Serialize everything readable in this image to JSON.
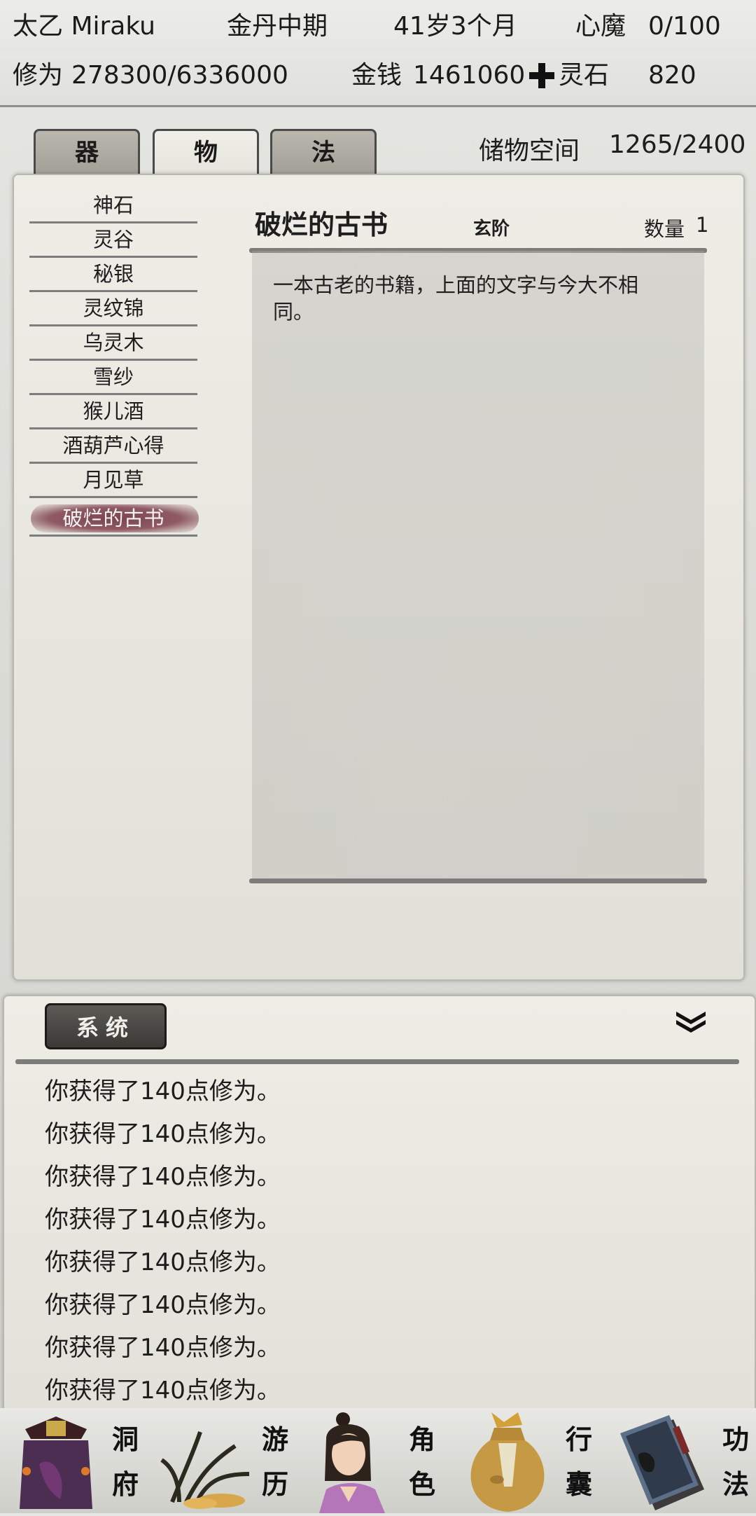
{
  "status": {
    "name": "太乙 Miraku",
    "realm": "金丹中期",
    "age": "41岁3个月",
    "heart_demon_label": "心魔",
    "heart_demon_value": "0/100",
    "cultivation_label": "修为",
    "cultivation_value": "278300/6336000",
    "money_label": "金钱",
    "money_value": "1461060",
    "spirit_stone_label": "灵石",
    "spirit_stone_value": "820"
  },
  "tabs": [
    {
      "label": "器",
      "active": false
    },
    {
      "label": "物",
      "active": true
    },
    {
      "label": "法",
      "active": false
    }
  ],
  "storage": {
    "label": "储物空间",
    "value": "1265/2400"
  },
  "items": [
    {
      "label": "神石"
    },
    {
      "label": "灵谷"
    },
    {
      "label": "秘银"
    },
    {
      "label": "灵纹锦"
    },
    {
      "label": "乌灵木"
    },
    {
      "label": "雪纱"
    },
    {
      "label": "猴儿酒"
    },
    {
      "label": "酒葫芦心得"
    },
    {
      "label": "月见草"
    },
    {
      "label": "破烂的古书"
    }
  ],
  "detail": {
    "title": "破烂的古书",
    "grade": "玄阶",
    "quantity_label": "数量",
    "quantity_value": "1",
    "description_line1": "一本古老的书籍，上面的文字与今大不相",
    "description_line2": "同。"
  },
  "log": {
    "tab_label": "系统",
    "messages": [
      "你获得了140点修为。",
      "你获得了140点修为。",
      "你获得了140点修为。",
      "你获得了140点修为。",
      "你获得了140点修为。",
      "你获得了140点修为。",
      "你获得了140点修为。",
      "你获得了140点修为。"
    ]
  },
  "nav": [
    {
      "label_top": "洞",
      "label_bottom": "府",
      "icon": "cave-dwelling-icon"
    },
    {
      "label_top": "游",
      "label_bottom": "历",
      "icon": "travel-grass-icon"
    },
    {
      "label_top": "角",
      "label_bottom": "色",
      "icon": "character-portrait-icon"
    },
    {
      "label_top": "行",
      "label_bottom": "囊",
      "icon": "bag-icon"
    },
    {
      "label_top": "功",
      "label_bottom": "法",
      "icon": "books-icon"
    }
  ],
  "colors": {
    "selected_item": "#7b4450",
    "tab_border": "#4a4a4a",
    "divider": "#7c7c7a"
  }
}
